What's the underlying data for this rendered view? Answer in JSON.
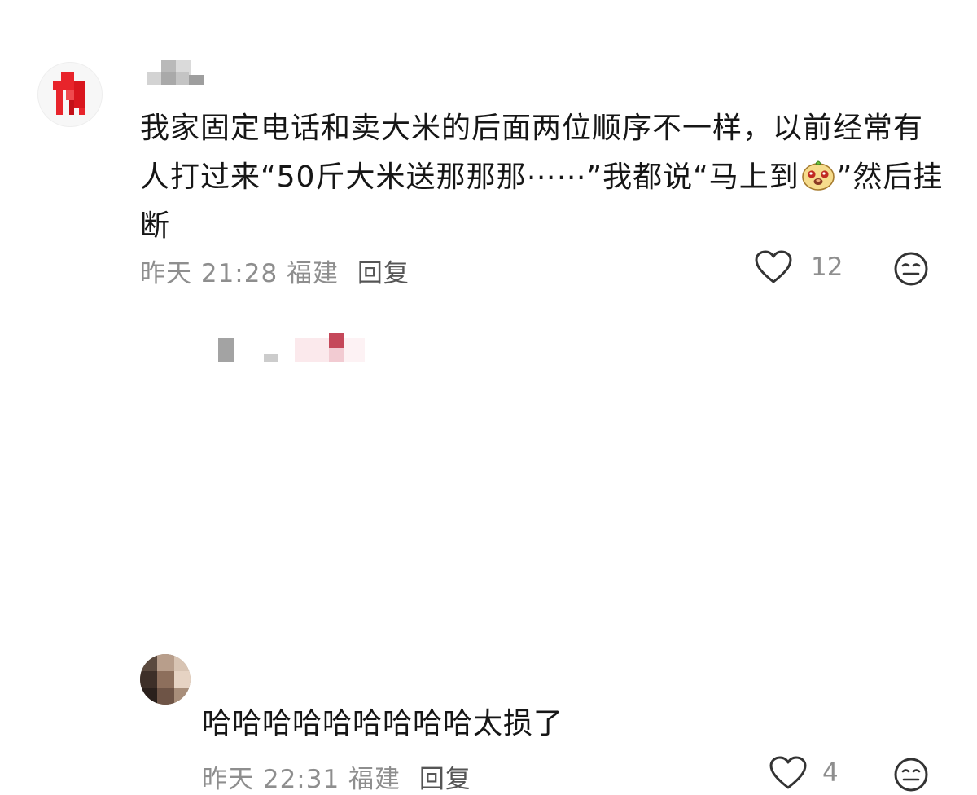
{
  "comments": [
    {
      "text_before_emoji": "我家固定电话和卖大米的后面两位顺序不一样，以前经常有人打过来“50斤大米送那那那⋯⋯”我都说“马上到",
      "emoji": "mole-face-emoji",
      "text_after_emoji": "”然后挂断",
      "meta": "昨天 21:28 福建",
      "reply_label": "回复",
      "like_count": "12",
      "colors": {
        "avatar_accent": "#e8242b"
      }
    },
    {
      "text": "哈哈哈哈哈哈哈哈哈太损了",
      "meta": "昨天 22:31 福建",
      "reply_label": "回复",
      "like_count": "4",
      "colors": {
        "username_accent": "#c5485a"
      }
    }
  ],
  "icons": [
    "heart-outline-icon",
    "speechless-face-icon"
  ],
  "colors": {
    "text": "#161616",
    "meta": "#8e8e8e",
    "reply": "#555555",
    "icon": "#333333"
  }
}
